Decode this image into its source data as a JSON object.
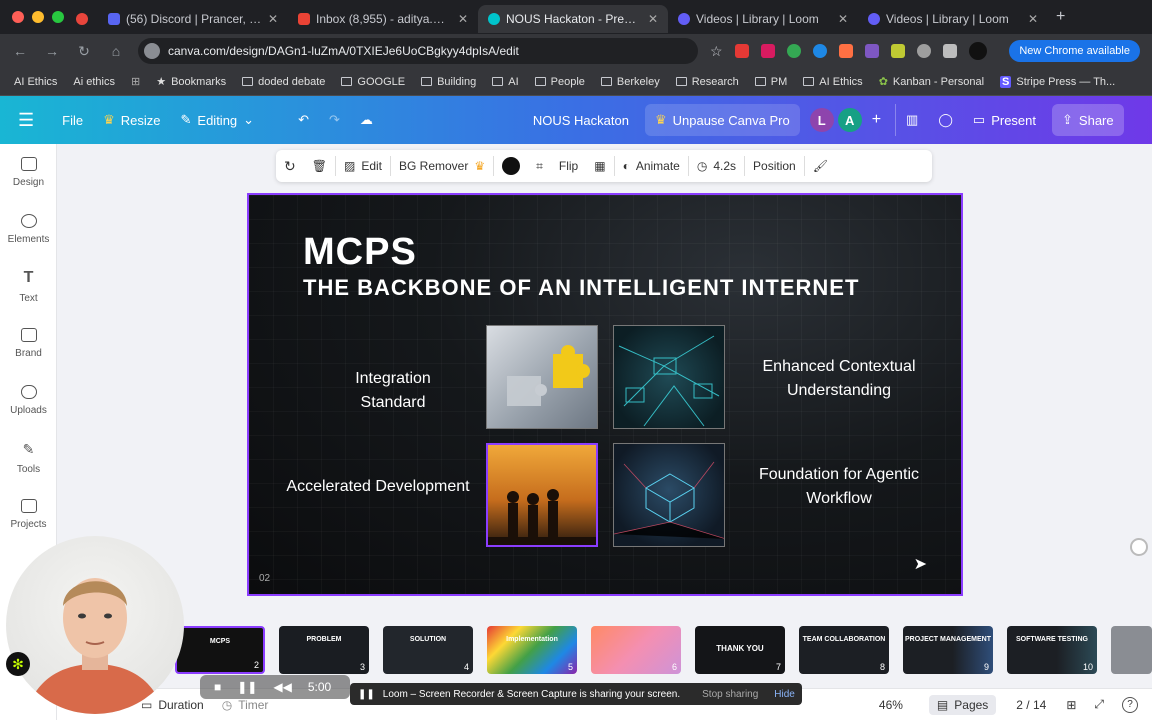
{
  "browser": {
    "tabs": [
      {
        "title": "(56) Discord | Prancer, Lars,",
        "color": "#5865f2",
        "active": false
      },
      {
        "title": "Inbox (8,955) - aditya.mehta...",
        "color": "#ea4335",
        "active": false
      },
      {
        "title": "NOUS Hackaton - Presen",
        "color": "#00c4cc",
        "active": true
      },
      {
        "title": "Videos | Library | Loom",
        "color": "#625df5",
        "active": false
      },
      {
        "title": "Videos | Library | Loom",
        "color": "#625df5",
        "active": false
      }
    ],
    "url": "canva.com/design/DAGn1-luZmA/0TXIEJe6UoCBgkyy4dpIsA/edit",
    "new_chrome": "New Chrome available",
    "bookmarks": [
      "AI Ethics",
      "Ai ethics",
      "Bookmarks",
      "doded debate",
      "GOOGLE",
      "Building",
      "AI",
      "People",
      "Berkeley",
      "Research",
      "PM",
      "AI Ethics",
      "Kanban - Personal",
      "Stripe Press — Th..."
    ]
  },
  "header": {
    "file": "File",
    "resize": "Resize",
    "editing": "Editing",
    "title": "NOUS Hackaton",
    "unpause": "Unpause Canva Pro",
    "avatar_l": "L",
    "avatar_a": "A",
    "present": "Present",
    "share": "Share"
  },
  "sidebar": {
    "items": [
      "Design",
      "Elements",
      "Text",
      "Brand",
      "Uploads",
      "Tools",
      "Projects"
    ]
  },
  "toolbar": {
    "edit": "Edit",
    "bg_remover": "BG Remover",
    "flip": "Flip",
    "animate": "Animate",
    "duration": "4.2s",
    "position": "Position"
  },
  "slide": {
    "title": "MCPS",
    "subtitle": "THE BACKBONE OF AN INTELLIGENT INTERNET",
    "label_1": "Integration Standard",
    "label_2": "Enhanced Contextual Understanding",
    "label_3": "Accelerated Development",
    "label_4": "Foundation for Agentic Workflow",
    "page_num": "02"
  },
  "strip": {
    "thumbs": [
      {
        "num": "2",
        "title": "MCPS"
      },
      {
        "num": "3",
        "title": "PROBLEM"
      },
      {
        "num": "4",
        "title": "SOLUTION"
      },
      {
        "num": "5",
        "title": "Implementation"
      },
      {
        "num": "6",
        "title": ""
      },
      {
        "num": "7",
        "title": "THANK YOU"
      },
      {
        "num": "8",
        "title": "TEAM COLLABORATION"
      },
      {
        "num": "9",
        "title": "PROJECT MANAGEMENT"
      },
      {
        "num": "10",
        "title": "SOFTWARE TESTING"
      }
    ]
  },
  "bottom": {
    "duration": "Duration",
    "timer": "Timer",
    "zoom": "46%",
    "pages": "Pages",
    "page_count": "2 / 14"
  },
  "loom": {
    "time": "5:00",
    "message": "Loom – Screen Recorder & Screen Capture is sharing your screen.",
    "stop": "Stop sharing",
    "hide": "Hide"
  }
}
